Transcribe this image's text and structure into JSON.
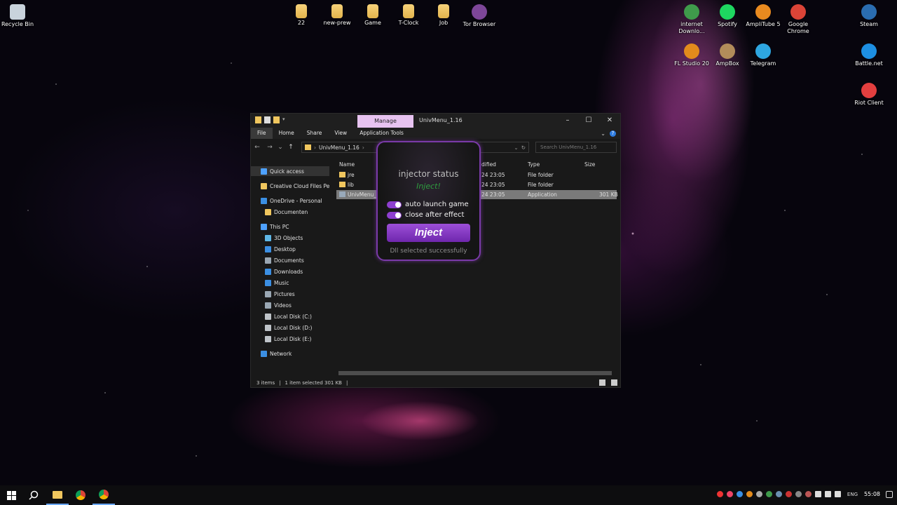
{
  "desktop": {
    "icons": [
      {
        "label": "Recycle Bin",
        "icon": "recycle-bin-icon",
        "color": "#c9d3dc"
      },
      {
        "label": "22",
        "icon": "folder-icon",
        "color": "#f0c65e"
      },
      {
        "label": "new-prew",
        "icon": "folder-icon",
        "color": "#f0c65e"
      },
      {
        "label": "Game",
        "icon": "folder-icon",
        "color": "#f0c65e"
      },
      {
        "label": "T-Clock",
        "icon": "folder-icon",
        "color": "#f0c65e"
      },
      {
        "label": "Job",
        "icon": "folder-icon",
        "color": "#f0c65e"
      },
      {
        "label": "Tor Browser",
        "icon": "tor-browser-icon",
        "color": "#7d4698"
      },
      {
        "label": "internet Downlo...",
        "icon": "idm-icon",
        "color": "#3f9b4b"
      },
      {
        "label": "Spotify",
        "icon": "spotify-icon",
        "color": "#1ed760"
      },
      {
        "label": "AmpliTube 5",
        "icon": "amplitube-icon",
        "color": "#e98a1f"
      },
      {
        "label": "Google Chrome",
        "icon": "chrome-icon",
        "color": "#db4437"
      },
      {
        "label": "Steam",
        "icon": "steam-icon",
        "color": "#2a6db0"
      },
      {
        "label": "FL Studio 20",
        "icon": "fl-studio-icon",
        "color": "#e38b1c"
      },
      {
        "label": "AmpBox",
        "icon": "ampbox-icon",
        "color": "#b28c5a"
      },
      {
        "label": "Telegram",
        "icon": "telegram-icon",
        "color": "#2ea6e0"
      },
      {
        "label": "Battle.net",
        "icon": "battle-net-icon",
        "color": "#1d8fe2"
      },
      {
        "label": "Riot Client",
        "icon": "riot-client-icon",
        "color": "#e33f3f"
      }
    ]
  },
  "explorer": {
    "title": "UnivMenu_1.16",
    "manage_tab": "Manage",
    "ribbon_tabs": [
      "File",
      "Home",
      "Share",
      "View",
      "Application Tools"
    ],
    "address_path": "UnivMenu_1.16",
    "search_placeholder": "Search UnivMenu_1.16",
    "sidebar": [
      {
        "label": "Quick access",
        "icon": "star-icon",
        "color": "#4ea1ff"
      },
      {
        "label": "Creative Cloud Files Per",
        "icon": "creative-cloud-icon",
        "color": "#f0c65e"
      },
      {
        "label": "OneDrive - Personal",
        "icon": "onedrive-icon",
        "color": "#3b8fe3"
      },
      {
        "label": "Documenten",
        "icon": "folder-icon",
        "color": "#f0c65e"
      },
      {
        "label": "This PC",
        "icon": "pc-icon",
        "color": "#4ea1ff"
      },
      {
        "label": "3D Objects",
        "icon": "3d-objects-icon",
        "color": "#5fb7e6"
      },
      {
        "label": "Desktop",
        "icon": "desktop-icon",
        "color": "#3b8fe3"
      },
      {
        "label": "Documents",
        "icon": "documents-icon",
        "color": "#9aa7b3"
      },
      {
        "label": "Downloads",
        "icon": "downloads-icon",
        "color": "#3b8fe3"
      },
      {
        "label": "Music",
        "icon": "music-icon",
        "color": "#3b8fe3"
      },
      {
        "label": "Pictures",
        "icon": "pictures-icon",
        "color": "#9aa7b3"
      },
      {
        "label": "Videos",
        "icon": "videos-icon",
        "color": "#9aa7b3"
      },
      {
        "label": "Local Disk (C:)",
        "icon": "disk-icon",
        "color": "#bfc4c9"
      },
      {
        "label": "Local Disk (D:)",
        "icon": "disk-icon",
        "color": "#bfc4c9"
      },
      {
        "label": "Local Disk (E:)",
        "icon": "disk-icon",
        "color": "#bfc4c9"
      },
      {
        "label": "Network",
        "icon": "network-icon",
        "color": "#3b8fe3"
      }
    ],
    "columns": {
      "name": "Name",
      "date": "dified",
      "type": "Type",
      "size": "Size"
    },
    "files": [
      {
        "name": "jre",
        "date": "24 23:05",
        "type": "File folder",
        "size": ""
      },
      {
        "name": "lib",
        "date": "24 23:05",
        "type": "File folder",
        "size": ""
      },
      {
        "name": "UnivMenu_",
        "date": "24 23:05",
        "type": "Application",
        "size": "301 KB"
      }
    ],
    "status": {
      "items": "3 items",
      "selected": "1 item selected  301 KB"
    }
  },
  "injector": {
    "title": "injector status",
    "subtitle": "Inject!",
    "toggle_auto_launch": "auto launch game",
    "toggle_close_after": "close after effect",
    "inject_button": "Inject",
    "status": "Dll selected successfully",
    "accent": "#8e3fd0"
  },
  "taskbar": {
    "language": "ENG",
    "clock": "55:08"
  }
}
